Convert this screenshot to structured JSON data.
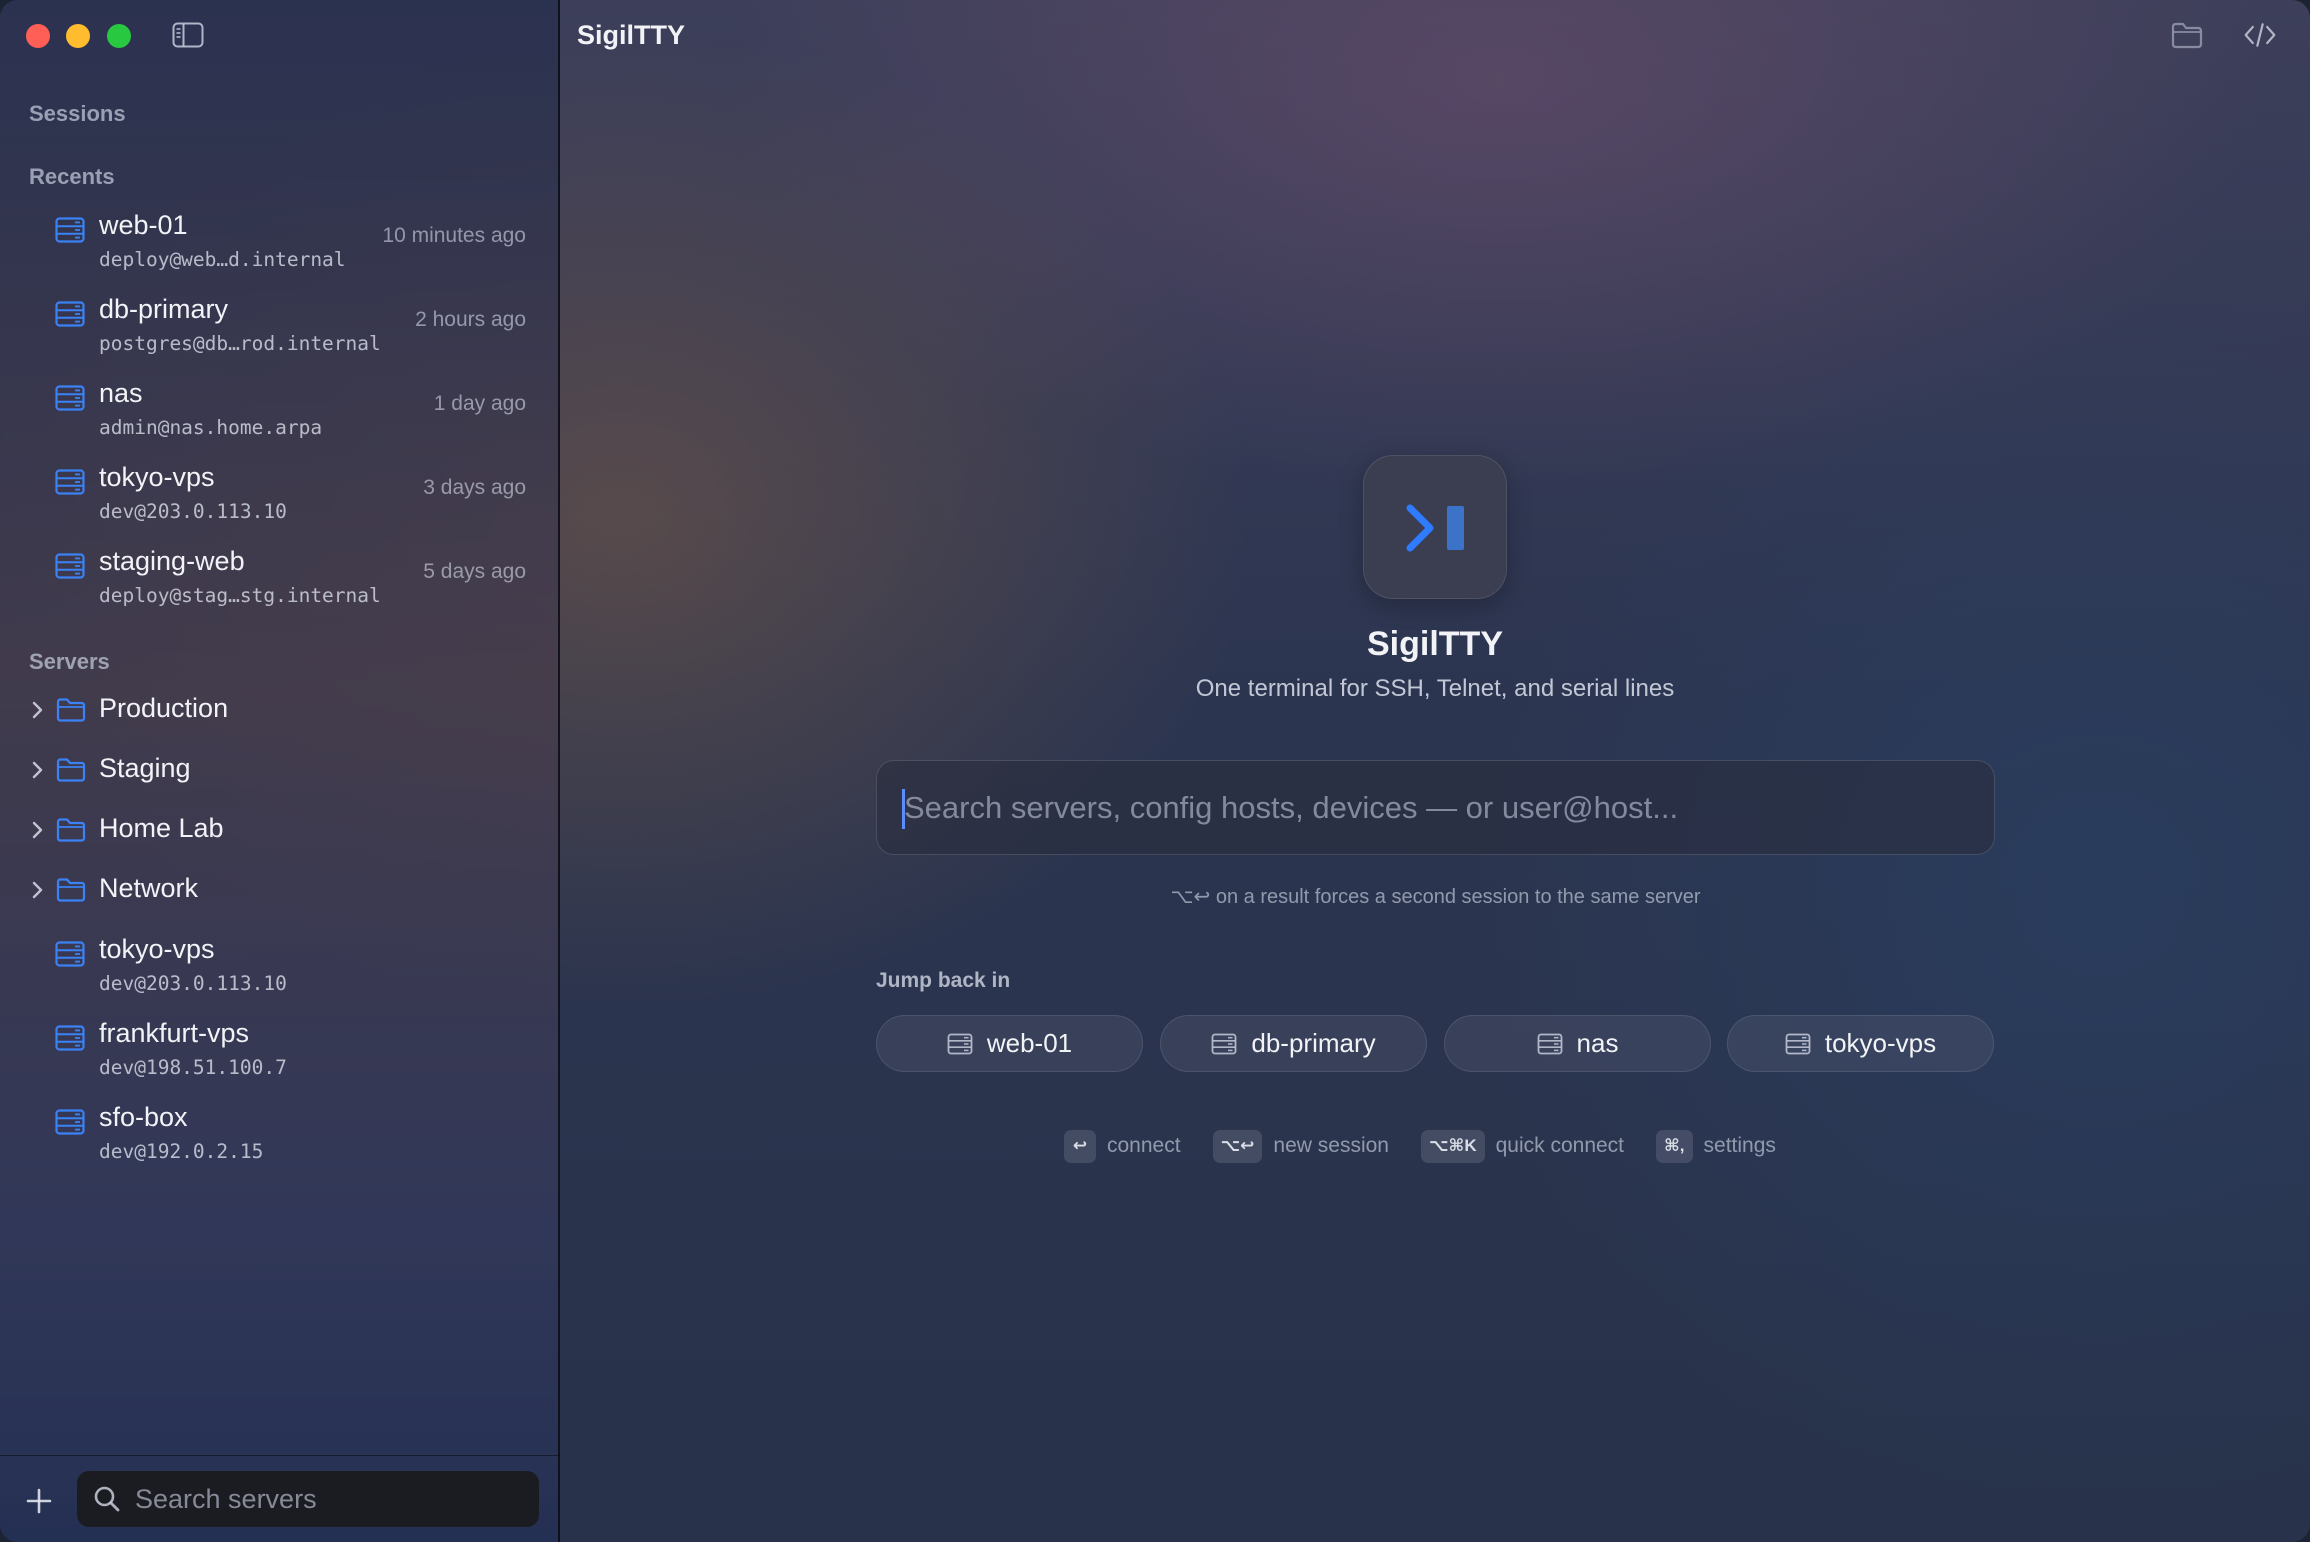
{
  "window": {
    "title": "SigilTTY"
  },
  "sidebar": {
    "sessions_label": "Sessions",
    "recents_label": "Recents",
    "recents": [
      {
        "name": "web-01",
        "host": "deploy@web…d.internal",
        "when": "10 minutes ago"
      },
      {
        "name": "db-primary",
        "host": "postgres@db…rod.internal",
        "when": "2 hours ago"
      },
      {
        "name": "nas",
        "host": "admin@nas.home.arpa",
        "when": "1 day ago"
      },
      {
        "name": "tokyo-vps",
        "host": "dev@203.0.113.10",
        "when": "3 days ago"
      },
      {
        "name": "staging-web",
        "host": "deploy@stag…stg.internal",
        "when": "5 days ago"
      }
    ],
    "servers_label": "Servers",
    "groups": [
      {
        "name": "Production"
      },
      {
        "name": "Staging"
      },
      {
        "name": "Home Lab"
      },
      {
        "name": "Network"
      }
    ],
    "servers": [
      {
        "name": "tokyo-vps",
        "host": "dev@203.0.113.10"
      },
      {
        "name": "frankfurt-vps",
        "host": "dev@198.51.100.7"
      },
      {
        "name": "sfo-box",
        "host": "dev@192.0.2.15"
      }
    ],
    "search": {
      "placeholder": "Search servers",
      "value": ""
    }
  },
  "main": {
    "title": "SigilTTY",
    "app_name": "SigilTTY",
    "tagline": "One terminal for SSH, Telnet, and serial lines",
    "search": {
      "placeholder": "Search servers, config hosts, devices — or user@host...",
      "value": ""
    },
    "hint": "⌥↩ on a result forces a second session to the same server",
    "jump_label": "Jump back in",
    "chips": [
      {
        "label": "web-01"
      },
      {
        "label": "db-primary"
      },
      {
        "label": "nas"
      },
      {
        "label": "tokyo-vps"
      }
    ],
    "shortcuts": [
      {
        "key": "↩",
        "label": "connect"
      },
      {
        "key": "⌥↩",
        "label": "new session"
      },
      {
        "key": "⌥⌘K",
        "label": "quick connect"
      },
      {
        "key": "⌘,",
        "label": "settings"
      }
    ]
  },
  "colors": {
    "accent": "#3b82f6",
    "traffic_red": "#ff5f57",
    "traffic_yellow": "#febc2e",
    "traffic_green": "#28c840"
  },
  "icons": {
    "server": "server-icon",
    "folder": "folder-icon",
    "chevron": "chevron-right-icon",
    "search": "search-icon",
    "add": "plus-icon",
    "sidebar_toggle": "sidebar-toggle-icon",
    "open_folder": "folder-icon",
    "code": "code-icon"
  }
}
